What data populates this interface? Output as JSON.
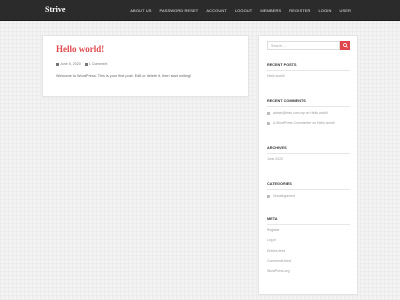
{
  "header": {
    "site_title": "Strive",
    "nav": [
      "ABOUT US",
      "PASSWORD RESET",
      "ACCOUNT",
      "LOGOUT",
      "MEMBERS",
      "REGISTER",
      "LOGIN",
      "USER"
    ]
  },
  "post": {
    "title": "Hello world!",
    "date": "June 5, 2020",
    "comments": "1 Comment",
    "excerpt": "Welcome to WordPress. This is your first post. Edit or delete it, then start writing!"
  },
  "sidebar": {
    "search_placeholder": "Search ...",
    "recent_posts": {
      "title": "RECENT POSTS",
      "items": [
        "Hello world!"
      ]
    },
    "recent_comments": {
      "title": "RECENT COMMENTS",
      "items": [
        "admin@fmtc.com.wp on Hello world!",
        "A WordPress Commenter on Hello world!"
      ]
    },
    "archives": {
      "title": "ARCHIVES",
      "items": [
        "June 2020"
      ]
    },
    "categories": {
      "title": "CATEGORIES",
      "items": [
        "Uncategorized"
      ]
    },
    "meta": {
      "title": "META",
      "items": [
        "Register",
        "Log in",
        "Entries feed",
        "Comments feed",
        "WordPress.org"
      ]
    }
  },
  "colors": {
    "accent": "#e0474c",
    "topbar": "#2b2b2b"
  }
}
